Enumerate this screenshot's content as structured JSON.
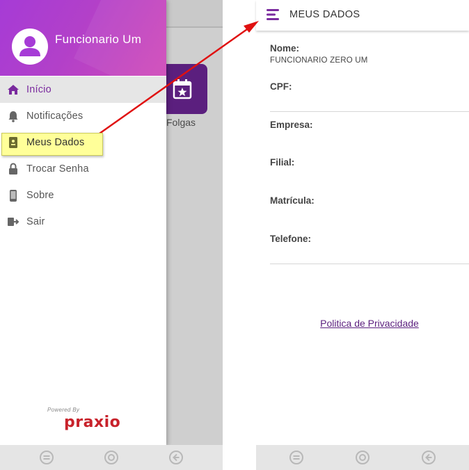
{
  "left_screen": {
    "background_tile_label": "Folgas",
    "user": {
      "name": "Funcionario Um"
    },
    "menu_items": [
      {
        "label": "Início",
        "icon": "home-icon",
        "active": true
      },
      {
        "label": "Notificações",
        "icon": "bell-icon",
        "active": false
      },
      {
        "label": "Meus Dados",
        "icon": "id-badge-icon",
        "active": false,
        "highlighted": true
      },
      {
        "label": "Trocar Senha",
        "icon": "lock-icon",
        "active": false
      },
      {
        "label": "Sobre",
        "icon": "phone-icon",
        "active": false
      },
      {
        "label": "Sair",
        "icon": "logout-icon",
        "active": false
      }
    ],
    "powered_by": "Powered By",
    "brand": "praxio"
  },
  "right_screen": {
    "title": "MEUS DADOS",
    "fields": {
      "nome_label": "Nome:",
      "nome_value": "FUNCIONARIO ZERO UM",
      "cpf_label": "CPF:",
      "empresa_label": "Empresa:",
      "filial_label": "Filial:",
      "matricula_label": "Matrícula:",
      "telefone_label": "Telefone:"
    },
    "privacy_link": "Politica de Privacidade"
  },
  "colors": {
    "accent_purple": "#7a2a9e",
    "header_gradient_start": "#a63bd6",
    "header_gradient_end": "#d04ab8",
    "highlight_yellow": "#ffff99",
    "annotation_arrow": "#e01010",
    "brand_red": "#c8222b"
  }
}
